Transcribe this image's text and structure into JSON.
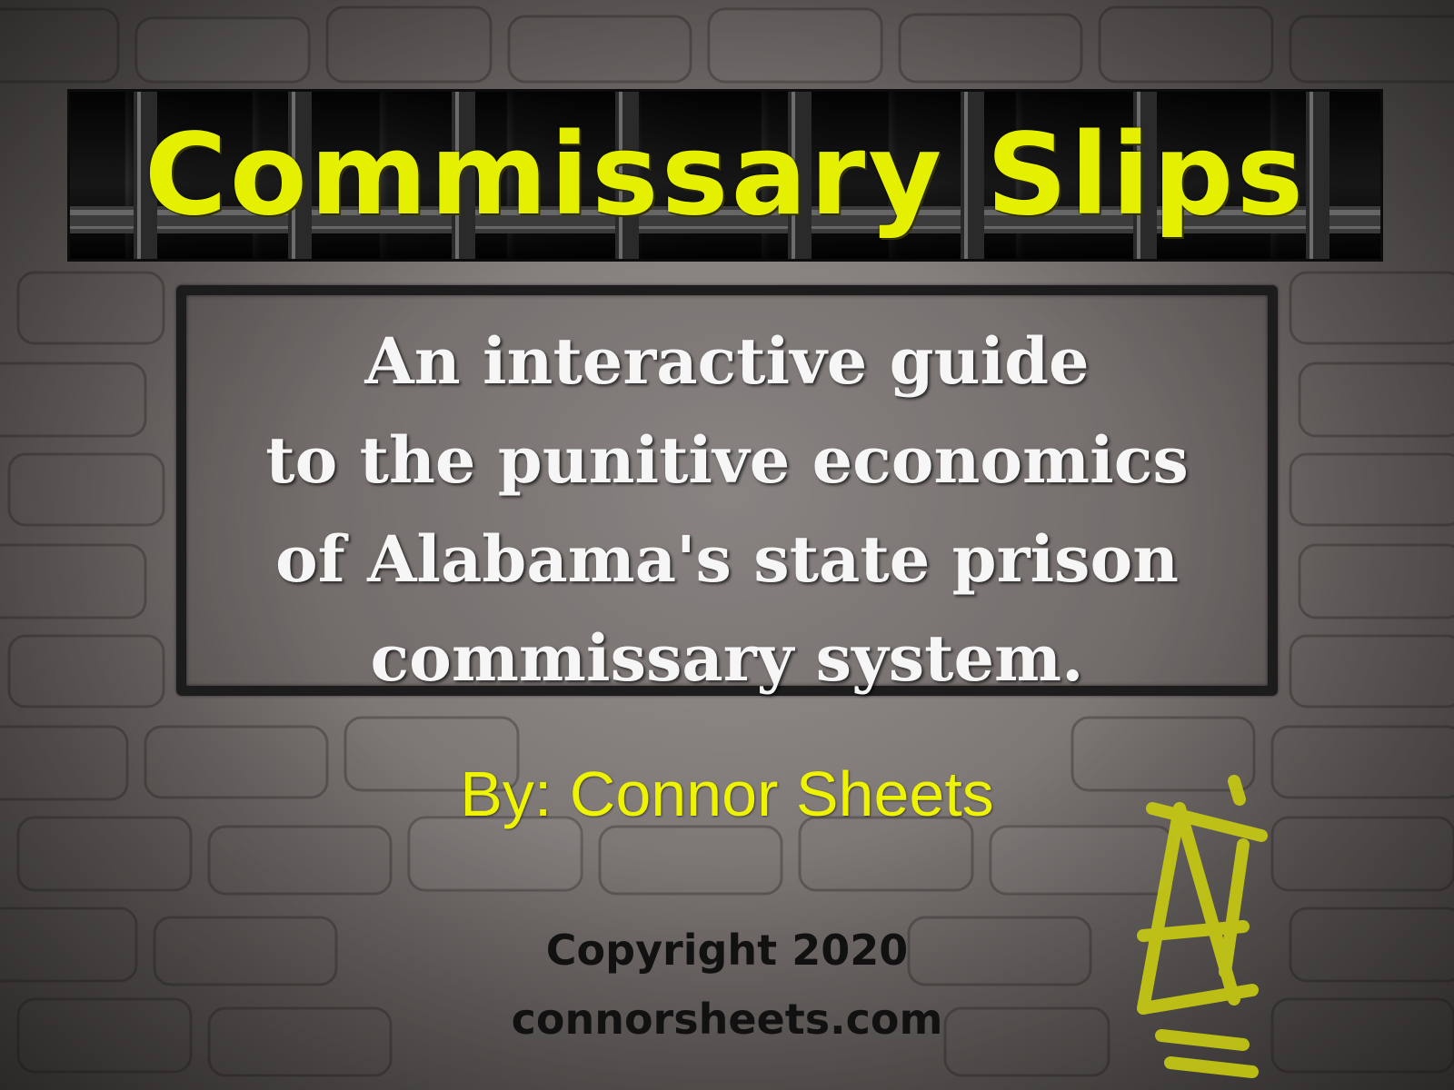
{
  "title_banner": {
    "title": "Commissary Slips"
  },
  "subtitle": {
    "lines": [
      "An interactive guide",
      "to the punitive economics",
      "of Alabama's state prison",
      "commissary system."
    ]
  },
  "byline": "By: Connor Sheets",
  "copyright": "Copyright 2020",
  "website": "connorsheets.com",
  "colors": {
    "title_yellow": "#e4f000",
    "byline_yellow": "#eef400",
    "subtitle_white": "#f6f6f6",
    "footer_black": "#111111",
    "wall_gray": "#7c7674"
  },
  "decor": {
    "background": "brick-wall",
    "graffiti": "yellow-tag-graffiti"
  }
}
